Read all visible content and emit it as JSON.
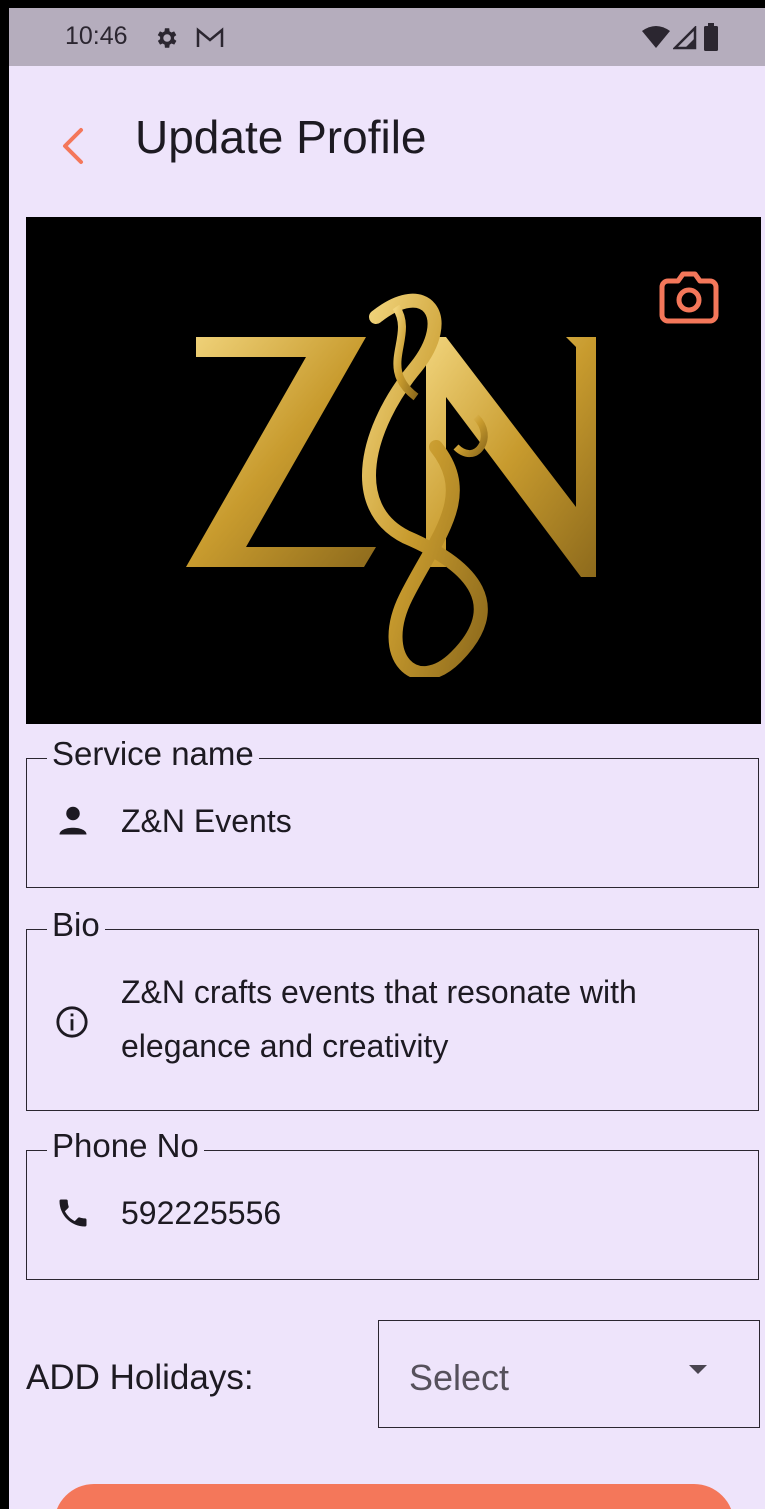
{
  "status_bar": {
    "time": "10:46",
    "icons": [
      "gear-icon",
      "gmail-icon",
      "wifi-icon",
      "signal-icon",
      "battery-icon"
    ]
  },
  "app_bar": {
    "back_icon": "chevron-left-icon",
    "title": "Update Profile"
  },
  "banner": {
    "logo_text": "Z&N",
    "camera_icon": "camera-icon"
  },
  "form": {
    "service_name": {
      "label": "Service name",
      "value": "Z&N Events",
      "icon": "person-icon"
    },
    "bio": {
      "label": "Bio",
      "value_line1": "Z&N crafts events that resonate with",
      "value_line2": "elegance and creativity",
      "icon": "info-icon"
    },
    "phone": {
      "label": "Phone No",
      "value": "592225556",
      "icon": "phone-icon"
    },
    "holidays": {
      "label": "ADD Holidays:",
      "selected": "Select"
    }
  },
  "colors": {
    "accent": "#f4775a",
    "background": "#eee4fb",
    "status_bar": "#b5adbd",
    "gold": "#d4a93a"
  }
}
